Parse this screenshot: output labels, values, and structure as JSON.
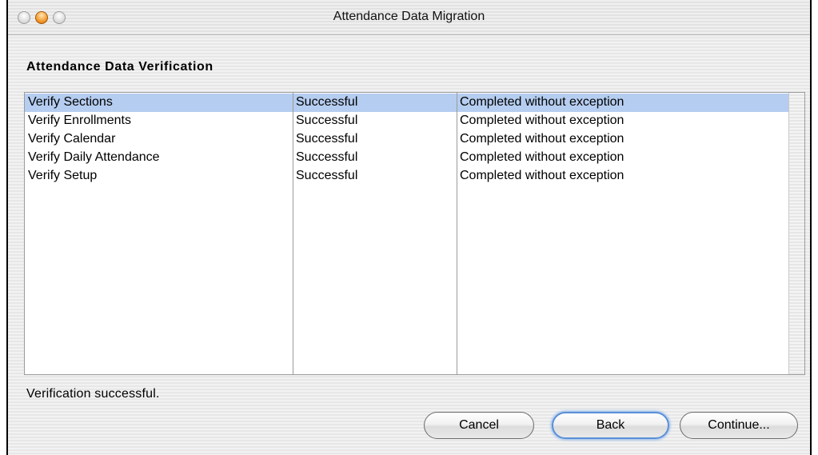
{
  "window": {
    "title": "Attendance Data Migration"
  },
  "heading": "Attendance Data Verification",
  "table": {
    "rows": [
      {
        "step": "Verify Sections",
        "status": "Successful",
        "detail": "Completed without exception",
        "selected": true
      },
      {
        "step": "Verify Enrollments",
        "status": "Successful",
        "detail": "Completed without exception",
        "selected": false
      },
      {
        "step": "Verify Calendar",
        "status": "Successful",
        "detail": "Completed without exception",
        "selected": false
      },
      {
        "step": "Verify Daily Attendance",
        "status": "Successful",
        "detail": "Completed without exception",
        "selected": false
      },
      {
        "step": "Verify Setup",
        "status": "Successful",
        "detail": "Completed without exception",
        "selected": false
      }
    ]
  },
  "status_message": "Verification successful.",
  "buttons": {
    "cancel": "Cancel",
    "back": "Back",
    "continue": "Continue..."
  },
  "colors": {
    "selection": "#b5cdf0",
    "default_button_glow": "#5a8fd6"
  }
}
